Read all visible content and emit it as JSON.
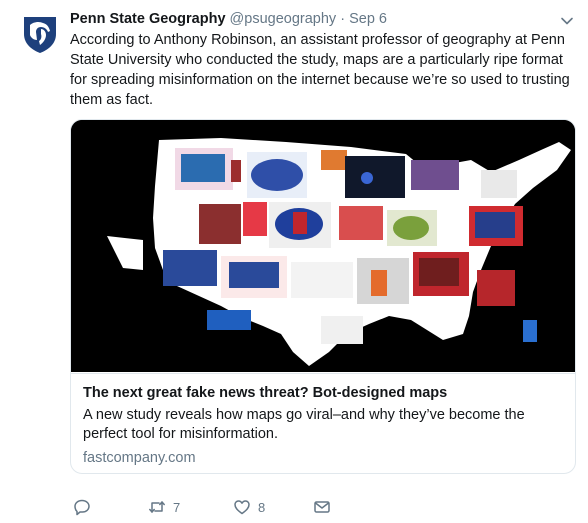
{
  "tweet": {
    "author_name": "Penn State Geography",
    "author_handle": "@psugeography",
    "separator": "·",
    "date": "Sep 6",
    "text": "According to Anthony Robinson, an assistant professor of geography at Penn State University who conducted the study, maps are a particularly ripe format for spreading misinformation on the internet because we’re so used to trusting them as fact."
  },
  "card": {
    "image_alt": "map-collage-of-united-states",
    "title": "The next great fake news threat? Bot-designed maps",
    "description": "A new study reveals how maps go viral–and why they’ve become the perfect tool for misinformation.",
    "domain": "fastcompany.com"
  },
  "actions": {
    "reply_icon": "reply-icon",
    "retweet_icon": "retweet-icon",
    "retweet_count": "7",
    "like_icon": "heart-icon",
    "like_count": "8",
    "dm_icon": "envelope-icon"
  },
  "colors": {
    "accent": "#1da1f2",
    "muted": "#657786",
    "text": "#14171a",
    "border": "#e1e8ed",
    "psu_navy": "#1e407c"
  }
}
